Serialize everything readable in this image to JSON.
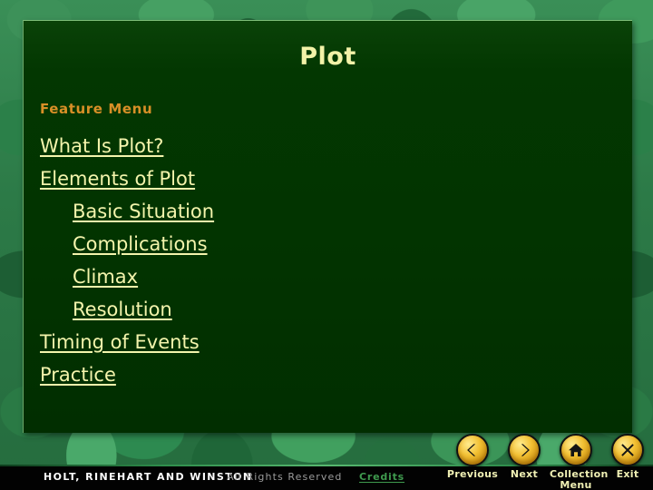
{
  "page": {
    "title": "Plot",
    "section_label": "Feature Menu"
  },
  "menu": {
    "items": [
      {
        "label": "What Is Plot?",
        "indent": false
      },
      {
        "label": "Elements of Plot",
        "indent": false
      },
      {
        "label": "Basic Situation",
        "indent": true
      },
      {
        "label": "Complications",
        "indent": true
      },
      {
        "label": "Climax",
        "indent": true
      },
      {
        "label": "Resolution",
        "indent": true
      },
      {
        "label": "Timing of Events",
        "indent": false
      },
      {
        "label": "Practice",
        "indent": false
      }
    ]
  },
  "footer": {
    "publisher": "HOLT, RINEHART AND WINSTON",
    "rights": "All Rights Reserved",
    "credits": "Credits"
  },
  "nav": {
    "buttons": [
      {
        "icon": "chevron-left-icon",
        "label": "Previous"
      },
      {
        "icon": "chevron-right-icon",
        "label": "Next"
      },
      {
        "icon": "home-icon",
        "label": "Collection\nMenu"
      },
      {
        "icon": "close-x-icon",
        "label": "Exit"
      }
    ]
  },
  "colors": {
    "title_yellow": "#f2f2a8",
    "link_yellow": "#f4f4ac",
    "feature_orange": "#d88f27",
    "panel_green": "#023300",
    "background_green": "#2f7d4a",
    "button_gold": "#f2c033",
    "credits_green": "#3f9a4e"
  }
}
